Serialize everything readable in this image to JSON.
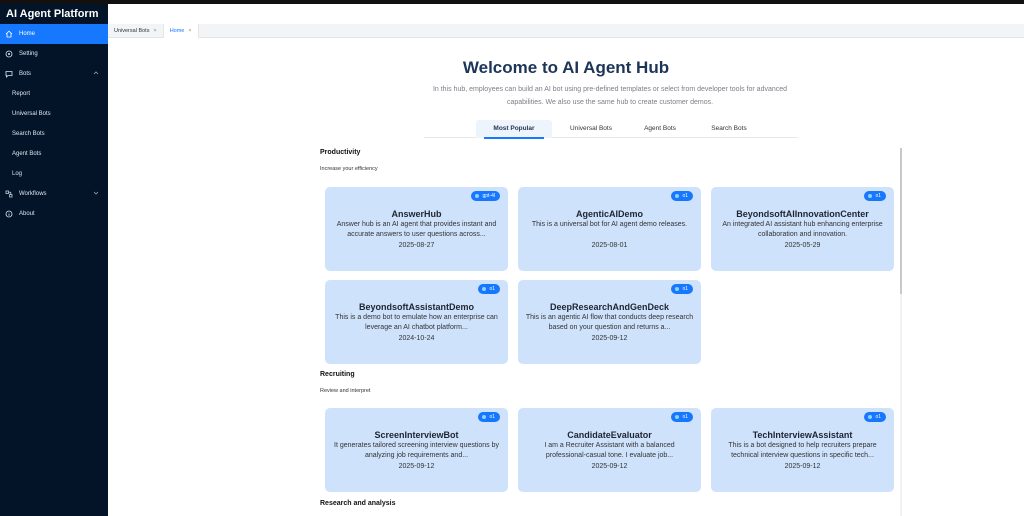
{
  "app": {
    "title": "AI Agent Platform"
  },
  "sidebar": {
    "items": [
      {
        "label": "Home",
        "icon": "home-icon"
      },
      {
        "label": "Setting",
        "icon": "gear-icon"
      },
      {
        "label": "Bots",
        "icon": "chat-icon"
      },
      {
        "label": "Report"
      },
      {
        "label": "Universal Bots"
      },
      {
        "label": "Search Bots"
      },
      {
        "label": "Agent Bots"
      },
      {
        "label": "Log"
      },
      {
        "label": "Workflows",
        "icon": "workflow-icon"
      },
      {
        "label": "About",
        "icon": "info-icon"
      }
    ]
  },
  "tabs": [
    {
      "label": "Universal Bots",
      "close": "×"
    },
    {
      "label": "Home",
      "close": "×"
    }
  ],
  "hero": {
    "title": "Welcome to AI Agent Hub",
    "description": "In this hub, employees can build an AI bot using pre-defined templates or select from developer tools for advanced capabilities. We also use the same hub to create customer demos."
  },
  "filters": [
    "Most Popular",
    "Universal Bots",
    "Agent Bots",
    "Search Bots"
  ],
  "sections": [
    {
      "title": "Productivity",
      "subtitle": "Increase your efficiency",
      "cards": [
        {
          "name": "AnswerHub",
          "badge": "gpt-4l",
          "desc": "Answer hub is an AI agent that provides instant and accurate answers to user questions across...",
          "date": "2025-08-27"
        },
        {
          "name": "AgenticAIDemo",
          "badge": "o1",
          "desc": "This is a universal bot for AI agent demo releases.",
          "date": "2025-08-01"
        },
        {
          "name": "BeyondsoftAIInnovationCenter",
          "badge": "o1",
          "desc": "An integrated AI assistant hub enhancing enterprise collaboration and innovation.",
          "date": "2025-05-29"
        },
        {
          "name": "BeyondsoftAssistantDemo",
          "badge": "o1",
          "desc": "This is a demo bot to emulate how an enterprise can leverage an AI chatbot platform...",
          "date": "2024-10-24"
        },
        {
          "name": "DeepResearchAndGenDeck",
          "badge": "o1",
          "desc": "This is an agentic AI flow that conducts deep research based on your question and returns a...",
          "date": "2025-09-12"
        }
      ]
    },
    {
      "title": "Recruiting",
      "subtitle": "Review and interpret",
      "cards": [
        {
          "name": "ScreenInterviewBot",
          "badge": "o1",
          "desc": "It generates tailored screening interview questions by analyzing job requirements and...",
          "date": "2025-09-12"
        },
        {
          "name": "CandidateEvaluator",
          "badge": "o1",
          "desc": "I am a Recruiter Assistant with a balanced professional-casual tone. I evaluate job...",
          "date": "2025-09-12"
        },
        {
          "name": "TechInterviewAssistant",
          "badge": "o1",
          "desc": "This is a bot designed to help recruiters prepare technical interview questions in specific tech...",
          "date": "2025-09-12"
        }
      ]
    },
    {
      "title": "Research and analysis",
      "subtitle": "",
      "cards": []
    }
  ]
}
